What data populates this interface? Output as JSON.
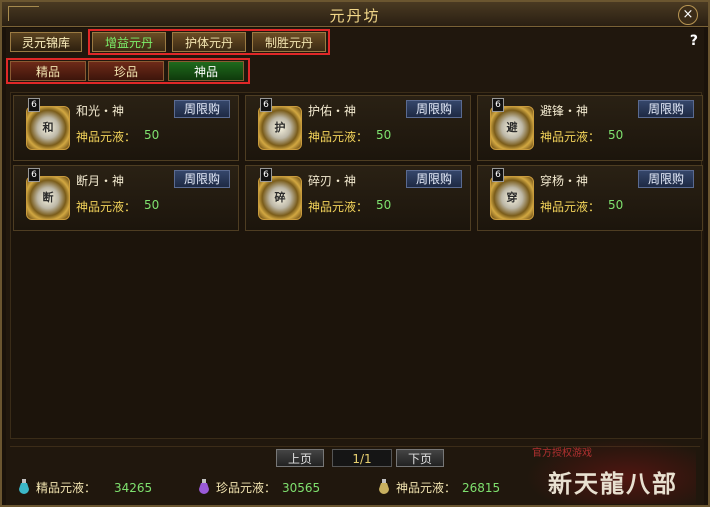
{
  "window": {
    "title": "元丹坊",
    "help_symbol": "?",
    "close_symbol": "×"
  },
  "tabs": [
    {
      "label": "灵元锦库"
    },
    {
      "label": "增益元丹"
    },
    {
      "label": "护体元丹"
    },
    {
      "label": "制胜元丹"
    }
  ],
  "subtabs": [
    {
      "label": "精品"
    },
    {
      "label": "珍品"
    },
    {
      "label": "神品"
    }
  ],
  "items": [
    {
      "name": "和光・神",
      "level": "6",
      "glyph": "和",
      "cost_label": "神品元液：",
      "cost": "50",
      "badge": "周限购"
    },
    {
      "name": "护佑・神",
      "level": "6",
      "glyph": "护",
      "cost_label": "神品元液：",
      "cost": "50",
      "badge": "周限购"
    },
    {
      "name": "避锋・神",
      "level": "6",
      "glyph": "避",
      "cost_label": "神品元液：",
      "cost": "50",
      "badge": "周限购"
    },
    {
      "name": "断月・神",
      "level": "6",
      "glyph": "断",
      "cost_label": "神品元液：",
      "cost": "50",
      "badge": "周限购"
    },
    {
      "name": "碎刃・神",
      "level": "6",
      "glyph": "碎",
      "cost_label": "神品元液：",
      "cost": "50",
      "badge": "周限购"
    },
    {
      "name": "穿杨・神",
      "level": "6",
      "glyph": "穿",
      "cost_label": "神品元液：",
      "cost": "50",
      "badge": "周限购"
    }
  ],
  "pager": {
    "prev": "上页",
    "page": "1/1",
    "next": "下页"
  },
  "resources": [
    {
      "label": "精品元液：",
      "value": "34265",
      "icon": "elixir-blue-icon"
    },
    {
      "label": "珍品元液：",
      "value": "30565",
      "icon": "elixir-purple-icon"
    },
    {
      "label": "神品元液：",
      "value": "26815",
      "icon": "elixir-gold-icon"
    }
  ],
  "logo": {
    "text": "新天龍八部",
    "small": "官方授权游戏"
  },
  "colors": {
    "accent_gold": "#f2d35a",
    "value_green": "#7ee06e",
    "active_subtab": "#1f6a1c",
    "highlight_red": "#e02828"
  }
}
